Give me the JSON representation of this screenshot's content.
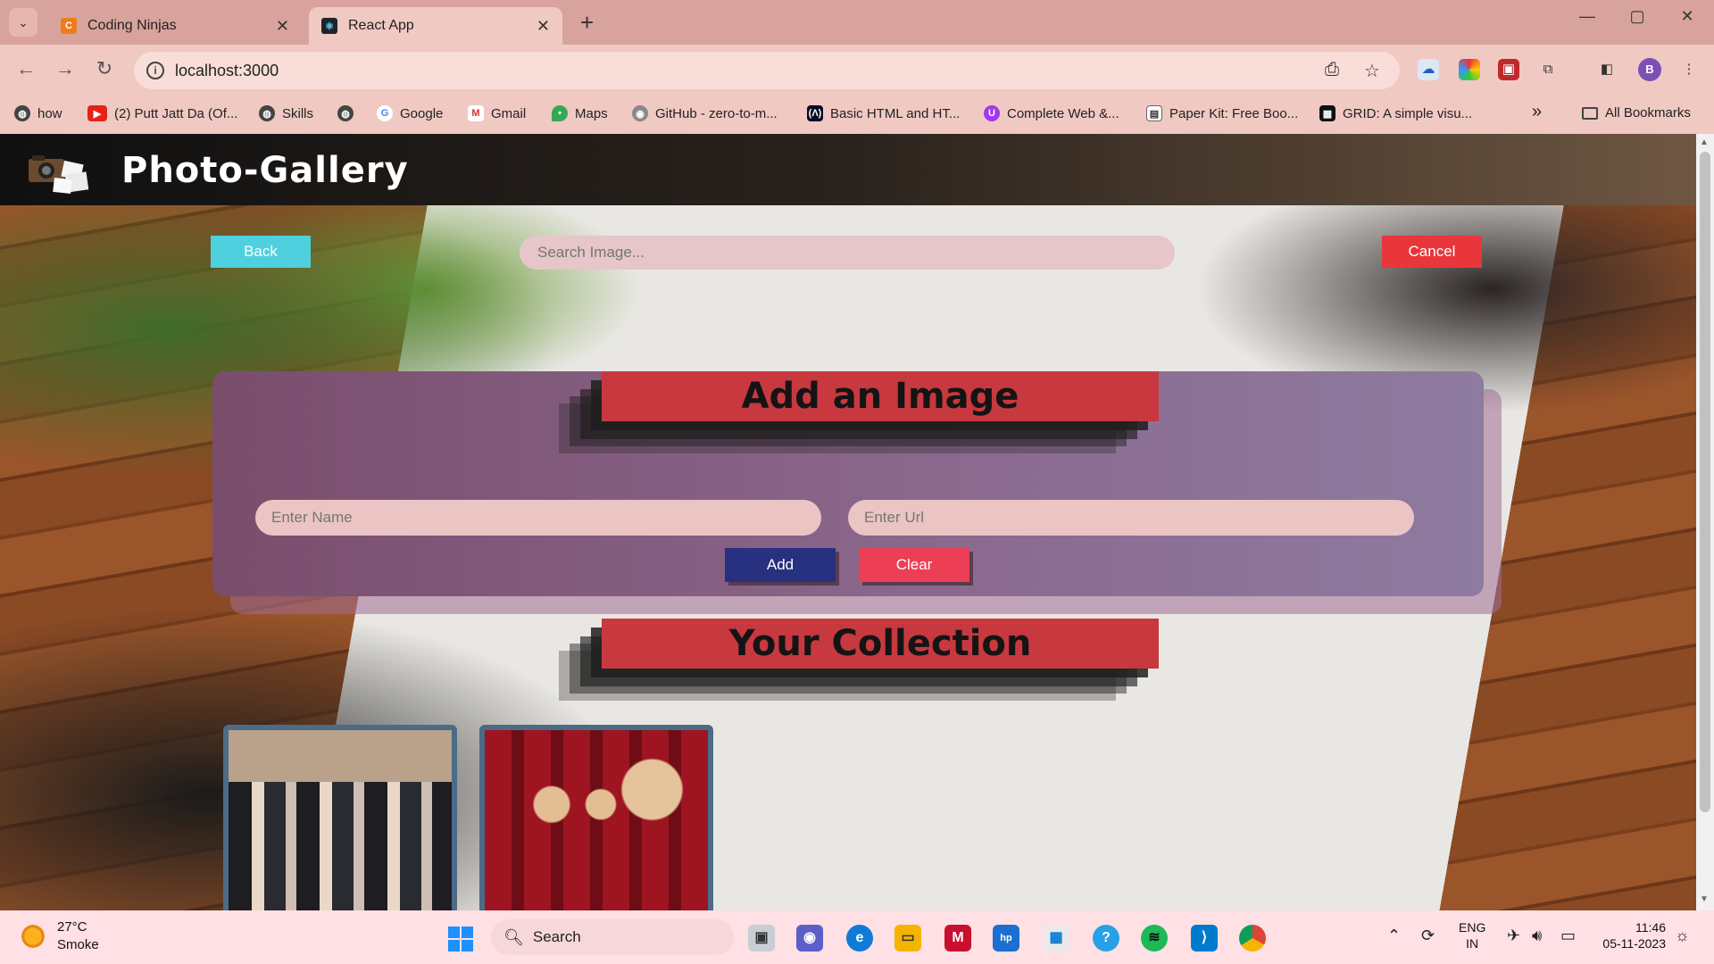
{
  "browser": {
    "tabs": [
      {
        "title": "Coding Ninjas",
        "active": false,
        "favicon": "coding-ninjas-icon"
      },
      {
        "title": "React App",
        "active": true,
        "favicon": "react-icon"
      }
    ],
    "new_tab": "+",
    "window_controls": {
      "minimize": "—",
      "maximize": "▢",
      "close": "✕"
    },
    "address": "localhost:3000",
    "bookmarks": [
      {
        "label": "how",
        "icon": "globe-icon"
      },
      {
        "label": "(2) Putt Jatt Da (Of...",
        "icon": "youtube-icon"
      },
      {
        "label": "Skills",
        "icon": "globe-icon"
      },
      {
        "label": "",
        "icon": "globe-icon"
      },
      {
        "label": "Google",
        "icon": "google-icon"
      },
      {
        "label": "Gmail",
        "icon": "gmail-icon"
      },
      {
        "label": "Maps",
        "icon": "maps-icon"
      },
      {
        "label": "GitHub - zero-to-m...",
        "icon": "github-icon"
      },
      {
        "label": "Basic HTML and HT...",
        "icon": "freecodecamp-icon"
      },
      {
        "label": "Complete Web &...",
        "icon": "udemy-icon"
      },
      {
        "label": "Paper Kit: Free Boo...",
        "icon": "paperkit-icon"
      },
      {
        "label": "GRID: A simple visu...",
        "icon": "grid-icon"
      }
    ],
    "bookmarks_overflow": "»",
    "all_bookmarks": "All Bookmarks",
    "profile_initial": "B"
  },
  "app": {
    "brand": "Photo-Gallery",
    "back_label": "Back",
    "cancel_label": "Cancel",
    "search_placeholder": "Search Image...",
    "add_section": {
      "heading": "Add an Image",
      "name_placeholder": "Enter Name",
      "url_placeholder": "Enter Url",
      "add_label": "Add",
      "clear_label": "Clear"
    },
    "collection_heading": "Your Collection",
    "colors": {
      "back": "#4fd0de",
      "cancel": "#e8363a",
      "heading_bar": "#c8383f",
      "add": "#283080",
      "clear": "#ec3f55"
    }
  },
  "taskbar": {
    "weather_temp": "27°C",
    "weather_desc": "Smoke",
    "search_label": "Search",
    "language": "ENG",
    "region": "IN",
    "time": "11:46",
    "date": "05-11-2023"
  }
}
